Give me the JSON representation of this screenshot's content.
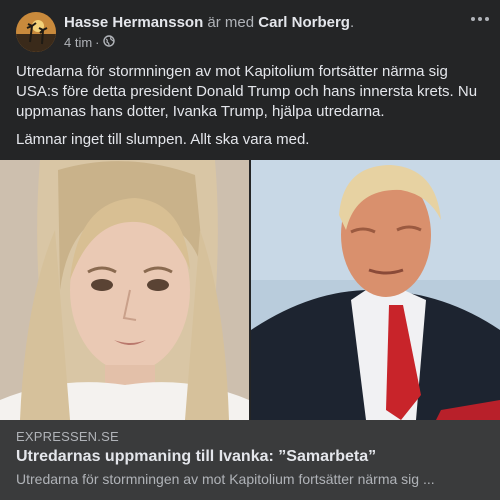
{
  "post": {
    "author": "Hasse Hermansson",
    "with_text": "är med",
    "tagged": "Carl Norberg",
    "tagged_suffix": ".",
    "time": "4 tim",
    "dot": "·",
    "privacy_icon": "globe-icon",
    "more_icon": "more-icon",
    "paragraphs": [
      "Utredarna för stormningen av mot Kapitolium fortsätter närma sig USA:s före detta president Donald Trump och hans innersta krets. Nu uppmanas hans dotter, Ivanka Trump, hjälpa utredarna.",
      "Lämnar inget till slumpen. Allt ska vara med."
    ]
  },
  "link": {
    "domain": "EXPRESSEN.SE",
    "title": "Utredarnas uppmaning till Ivanka: ”Samarbeta”",
    "description": "Utredarna för stormningen av mot Kapitolium fortsätter närma sig ..."
  },
  "colors": {
    "background": "#242526",
    "link_background": "#3a3b3c",
    "primary_text": "#e4e6eb",
    "secondary_text": "#b0b3b8"
  }
}
